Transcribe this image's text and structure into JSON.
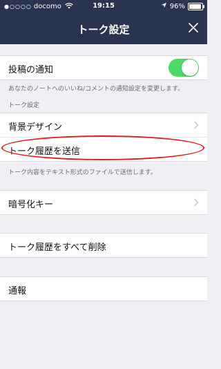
{
  "status": {
    "signal": "●○○○○",
    "carrier": "docomo",
    "time": "19:15",
    "battery": "96%",
    "battery_level": 0.96
  },
  "nav": {
    "title": "トーク設定"
  },
  "rows": {
    "post_notifications": {
      "label": "投稿の通知",
      "enabled": true
    },
    "background": {
      "label": "背景デザイン"
    },
    "export": {
      "label": "トーク履歴を送信"
    },
    "encryption": {
      "label": "暗号化キー"
    },
    "delete_all": {
      "label": "トーク履歴をすべて削除"
    },
    "report": {
      "label": "通報"
    }
  },
  "notes": {
    "post_notifications_desc": "あなたのノートへのいいね/コメントの通知設定を変更します。",
    "talk_settings_header": "トーク設定",
    "export_desc": "トーク内容をテキスト形式のファイルで送信します。"
  },
  "colors": {
    "navbar": "#2a3450",
    "toggle_on": "#4cd964",
    "highlight": "#e0201f"
  }
}
